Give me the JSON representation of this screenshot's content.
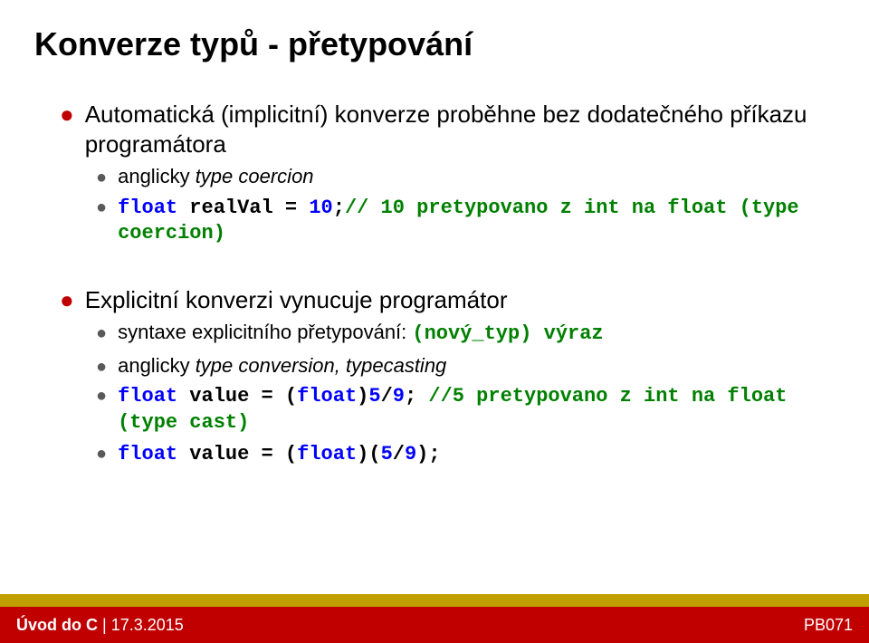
{
  "title": "Konverze typů - přetypování",
  "bullets": [
    {
      "level": 1,
      "text": "Automatická (implicitní) konverze proběhne bez dodatečného příkazu programátora"
    },
    {
      "level": 2,
      "pre": "anglicky ",
      "italic": "type coercion"
    },
    {
      "level": 2,
      "code_parts": {
        "kw1": "float",
        "mid1": " realVal = ",
        "num": "10",
        "mid2": ";",
        "comment": "// 10 pretypovano z int na float (type coercion)"
      }
    },
    {
      "gap": true
    },
    {
      "level": 1,
      "text": "Explicitní konverzi vynucuje programátor"
    },
    {
      "level": 2,
      "pre": "syntaxe explicitního přetypování: ",
      "code_green": "(nový_typ) výraz"
    },
    {
      "level": 2,
      "pre": "anglicky ",
      "italic": "type conversion, typecasting"
    },
    {
      "level": 2,
      "code5": {
        "kw1": "float",
        "mid1": " value = (",
        "kw2": "float",
        "mid2": ")",
        "num1": "5",
        "mid3": "/",
        "num2": "9",
        "mid4": "; ",
        "comment": "//5 pretypovano z int na float (type cast)"
      }
    },
    {
      "level": 2,
      "code6": {
        "kw1": "float",
        "mid1": " value = (",
        "kw2": "float",
        "mid2": ")(",
        "num1": "5",
        "mid3": "/",
        "num2": "9",
        "mid4": ");"
      }
    }
  ],
  "footer": {
    "left_prefix": "Úvod do C",
    "left_sep": " | ",
    "left_date": "17.3.2015",
    "right": "PB071"
  }
}
